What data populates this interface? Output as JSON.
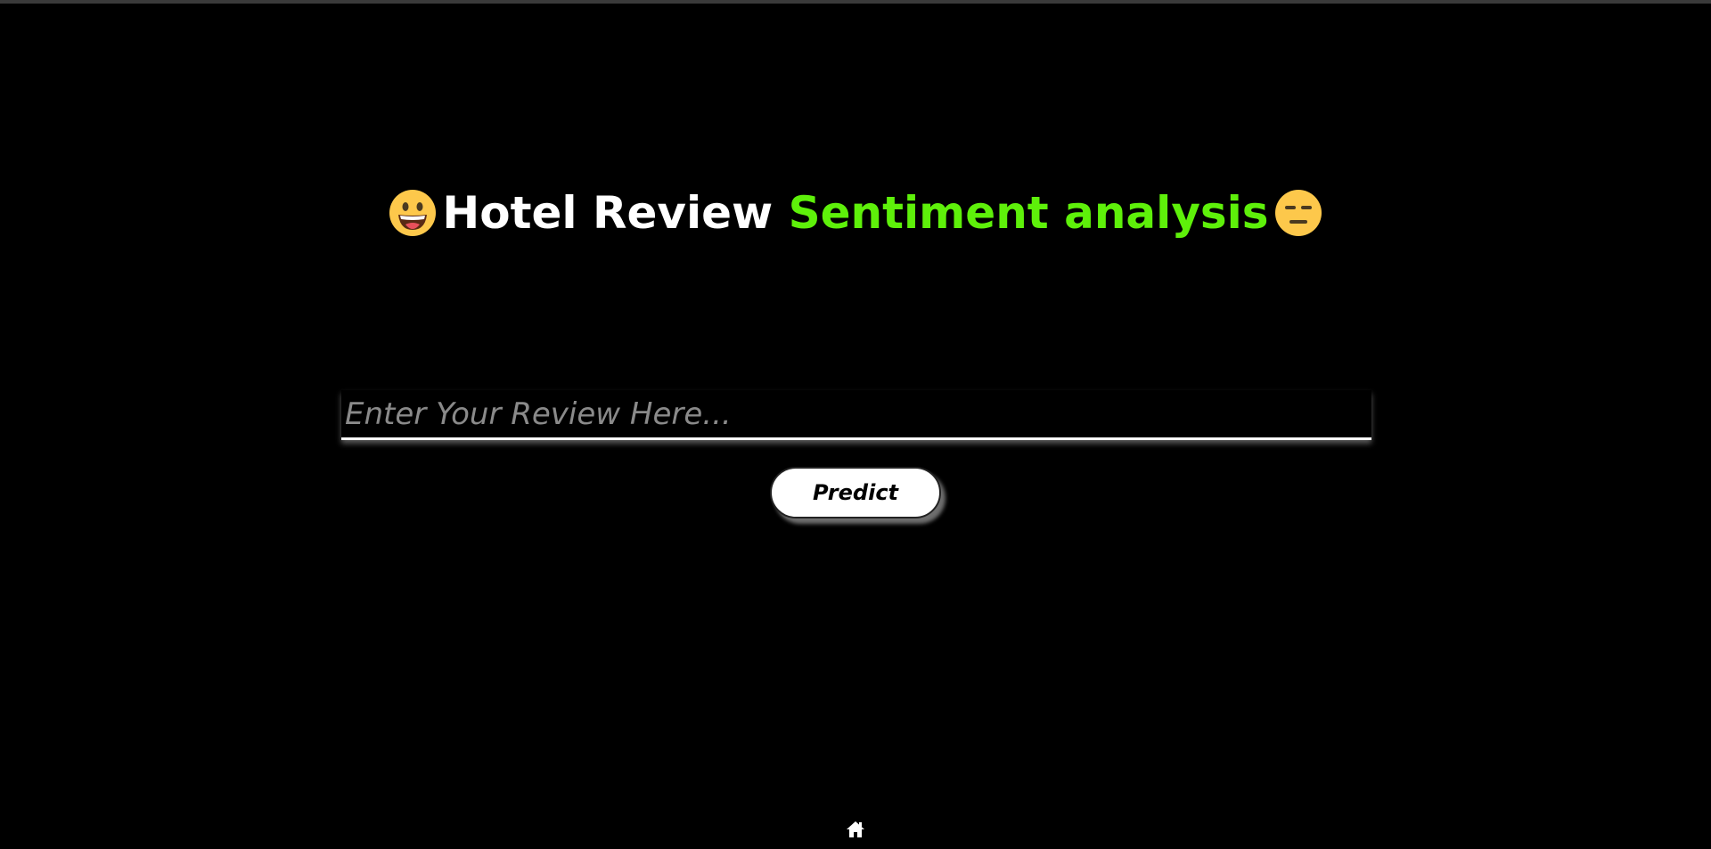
{
  "header": {
    "title_part1": "Hotel Review ",
    "title_part2": "Sentiment analysis",
    "left_icon": "grinning-face-icon",
    "right_icon": "expressionless-face-icon"
  },
  "form": {
    "review_placeholder": "Enter Your Review Here...",
    "review_value": "",
    "predict_label": "Predict"
  },
  "footer": {
    "home_icon": "home-icon"
  },
  "colors": {
    "background": "#000000",
    "title_white": "#ffffff",
    "title_green": "#5ef00a",
    "emoji_yellow": "#fdc84b",
    "placeholder": "#8a8a8a"
  }
}
